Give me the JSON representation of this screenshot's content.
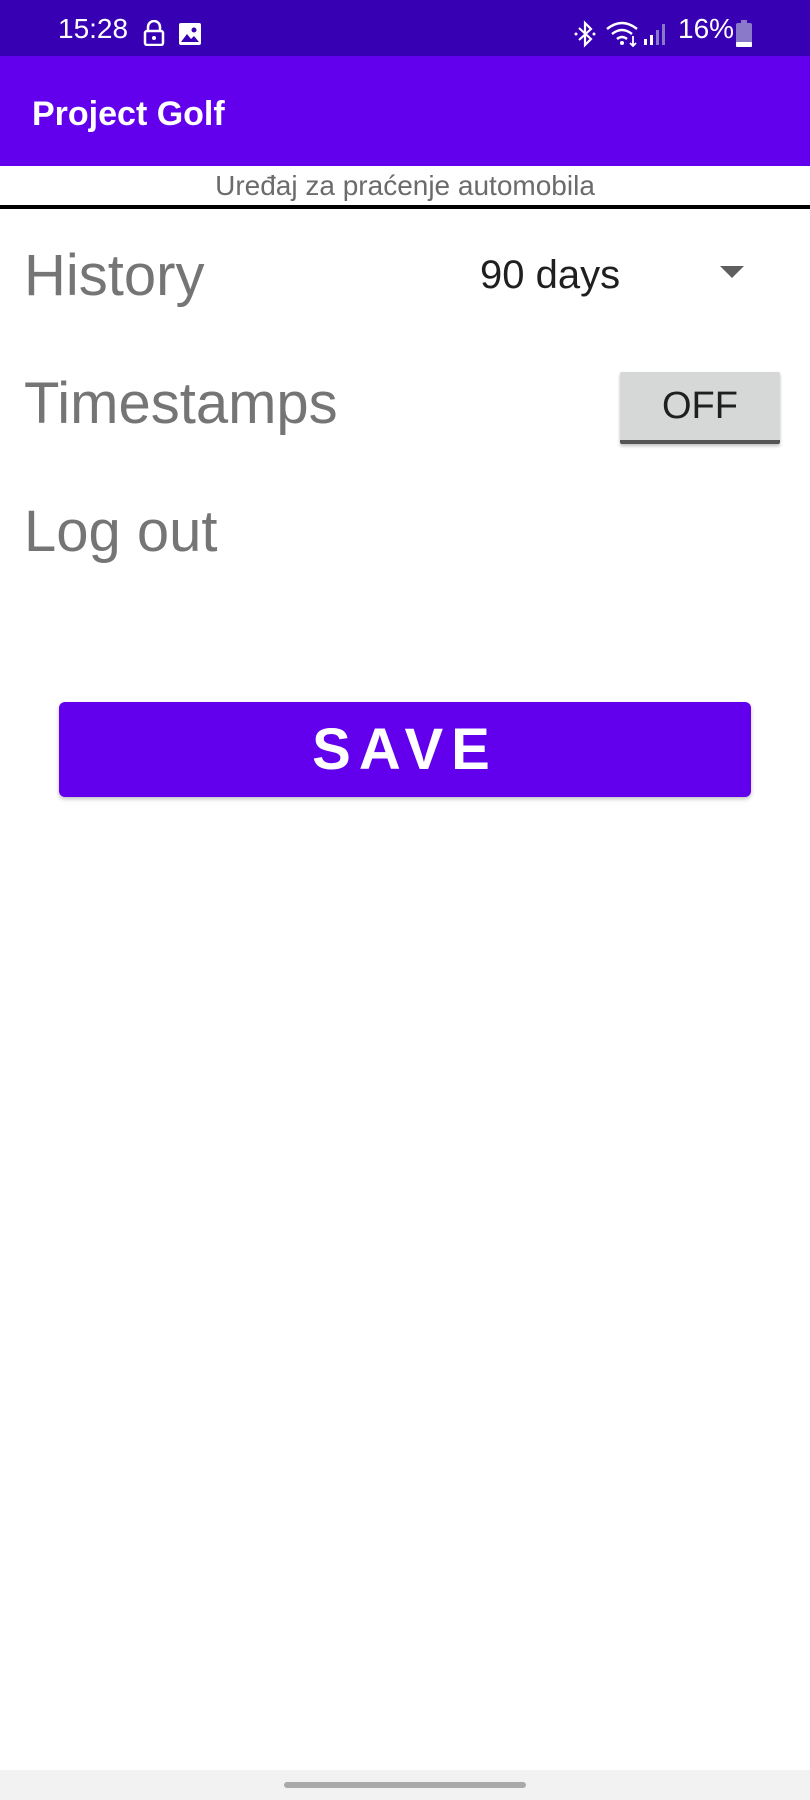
{
  "status_bar": {
    "time": "15:28",
    "battery": "16%",
    "icons": [
      "lock-icon",
      "image-icon",
      "bluetooth-icon",
      "wifi-icon",
      "signal-icon",
      "battery-icon"
    ]
  },
  "app_bar": {
    "title": "Project Golf",
    "color": "#6200ee"
  },
  "subtitle": "Uređaj za praćenje automobila",
  "settings": {
    "history": {
      "label": "History",
      "selected": "90 days"
    },
    "timestamps": {
      "label": "Timestamps",
      "toggle": "OFF"
    },
    "logout": {
      "label": "Log out"
    }
  },
  "save_button": {
    "label": "SAVE",
    "color": "#6200ee"
  }
}
